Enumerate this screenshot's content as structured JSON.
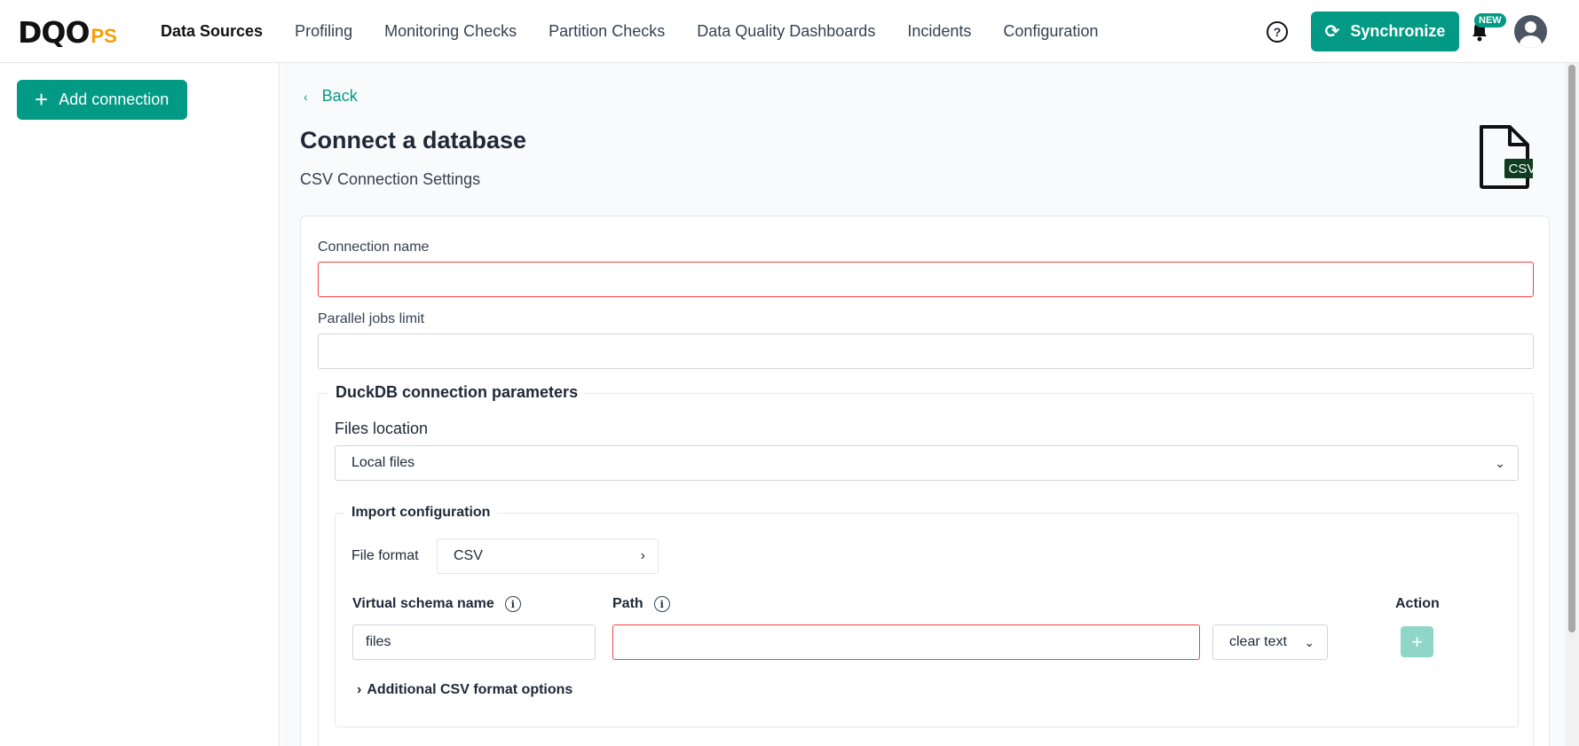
{
  "brand": {
    "logo_main": "DQO",
    "logo_suffix": "PS"
  },
  "nav": {
    "items": [
      {
        "label": "Data Sources",
        "active": true
      },
      {
        "label": "Profiling",
        "active": false
      },
      {
        "label": "Monitoring Checks",
        "active": false
      },
      {
        "label": "Partition Checks",
        "active": false
      },
      {
        "label": "Data Quality Dashboards",
        "active": false
      },
      {
        "label": "Incidents",
        "active": false
      },
      {
        "label": "Configuration",
        "active": false
      }
    ],
    "help_icon": "?",
    "synchronize_label": "Synchronize",
    "new_badge": "NEW"
  },
  "sidebar": {
    "add_connection_label": "Add connection"
  },
  "main": {
    "back_label": "Back",
    "title": "Connect a database",
    "subtitle": "CSV Connection Settings",
    "csv_icon_text": "CSV",
    "connection_name": {
      "label": "Connection name",
      "value": ""
    },
    "parallel_jobs": {
      "label": "Parallel jobs limit",
      "value": ""
    },
    "duckdb": {
      "legend": "DuckDB connection parameters",
      "files_location_label": "Files location",
      "files_location_value": "Local files",
      "import_config": {
        "legend": "Import configuration",
        "file_format_label": "File format",
        "file_format_value": "CSV",
        "columns": {
          "schema": "Virtual schema name",
          "path": "Path",
          "action": "Action"
        },
        "schema_value": "files",
        "path_value": "",
        "path_mode": "clear text",
        "additional_options_label": "Additional CSV format options"
      }
    }
  },
  "colors": {
    "accent": "#029a85",
    "error": "#ef4444",
    "logo_orange": "#f59e0b"
  }
}
